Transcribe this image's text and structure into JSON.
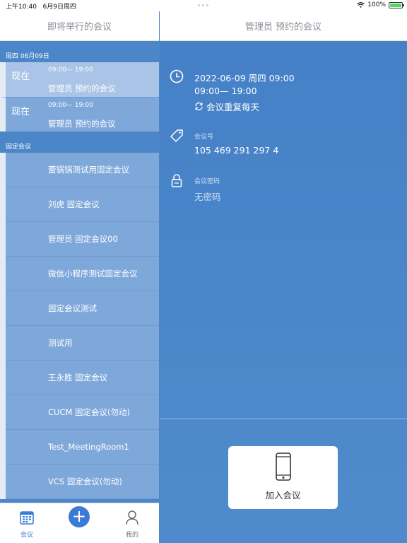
{
  "status_bar": {
    "time": "上午10:40",
    "date": "6月9日周四",
    "battery": "100%"
  },
  "left": {
    "header_title": "即将举行的会议",
    "upcoming_section": "周四 06月09日",
    "upcoming": [
      {
        "badge": "现在",
        "time": "09:00— 19:00",
        "title": "管理员 预约的会议"
      },
      {
        "badge": "现在",
        "time": "09:00— 19:00",
        "title": "管理员 预约的会议"
      }
    ],
    "fixed_section": "固定会议",
    "fixed": [
      "蕾锅锅测试用固定会议",
      "刘虎 固定会议",
      "管理员 固定会议00",
      "微信小程序测试固定会议",
      "固定会议测试",
      "测试用",
      "王永胜 固定会议",
      "CUCM 固定会议(勿动)",
      "Test_MeetingRoom1",
      "VCS 固定会议(勿动)"
    ]
  },
  "tabbar": {
    "meeting_label": "会议",
    "add_symbol": "+",
    "me_label": "我的"
  },
  "right": {
    "header_title": "管理员 预约的会议",
    "date": "2022-06-09 周四 09:00",
    "time_range": "09:00— 19:00",
    "repeat": "会议重复每天",
    "meeting_id_label": "会议号",
    "meeting_id": "105 469 291 297 4",
    "password_label": "会议密码",
    "password": "无密码",
    "join_label": "加入会议"
  },
  "colors": {
    "primary_blue": "#4a86c8",
    "selected_row": "#a9c4e6",
    "row_blue": "#7fa8da",
    "accent": "#3a7bd5"
  }
}
